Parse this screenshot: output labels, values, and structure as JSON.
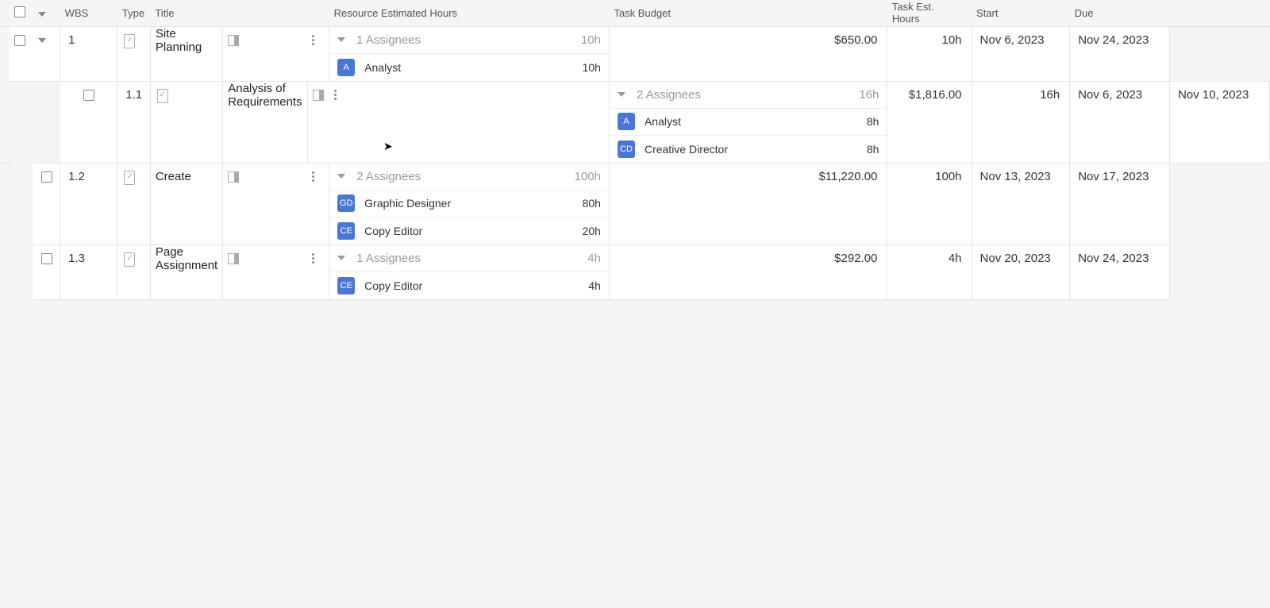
{
  "columns": {
    "wbs": "WBS",
    "type": "Type",
    "title": "Title",
    "resource": "Resource Estimated Hours",
    "budget": "Task Budget",
    "esthours": "Task Est. Hours",
    "start": "Start",
    "due": "Due"
  },
  "tasks": [
    {
      "level": 0,
      "wbs": "1",
      "title": "Site Planning",
      "assignees_label": "1 Assignees",
      "total_hours": "10h",
      "budget": "$650.00",
      "est_hours": "10h",
      "start": "Nov 6, 2023",
      "due": "Nov 24, 2023",
      "resources": [
        {
          "initials": "A",
          "name": "Analyst",
          "hours": "10h"
        }
      ]
    },
    {
      "level": 1,
      "wbs": "1.1",
      "title": "Analysis of Requirements",
      "assignees_label": "2 Assignees",
      "total_hours": "16h",
      "budget": "$1,816.00",
      "est_hours": "16h",
      "start": "Nov 6, 2023",
      "due": "Nov 10, 2023",
      "resources": [
        {
          "initials": "A",
          "name": "Analyst",
          "hours": "8h"
        },
        {
          "initials": "CD",
          "name": "Creative Director",
          "hours": "8h"
        }
      ]
    },
    {
      "level": 1,
      "wbs": "1.2",
      "title": "Create",
      "assignees_label": "2 Assignees",
      "total_hours": "100h",
      "budget": "$11,220.00",
      "est_hours": "100h",
      "start": "Nov 13, 2023",
      "due": "Nov 17, 2023",
      "resources": [
        {
          "initials": "GD",
          "name": "Graphic Designer",
          "hours": "80h"
        },
        {
          "initials": "CE",
          "name": "Copy Editor",
          "hours": "20h"
        }
      ]
    },
    {
      "level": 1,
      "wbs": "1.3",
      "title": "Page Assignment",
      "assignees_label": "1 Assignees",
      "total_hours": "4h",
      "budget": "$292.00",
      "est_hours": "4h",
      "start": "Nov 20, 2023",
      "due": "Nov 24, 2023",
      "resources": [
        {
          "initials": "CE",
          "name": "Copy Editor",
          "hours": "4h"
        }
      ]
    }
  ]
}
